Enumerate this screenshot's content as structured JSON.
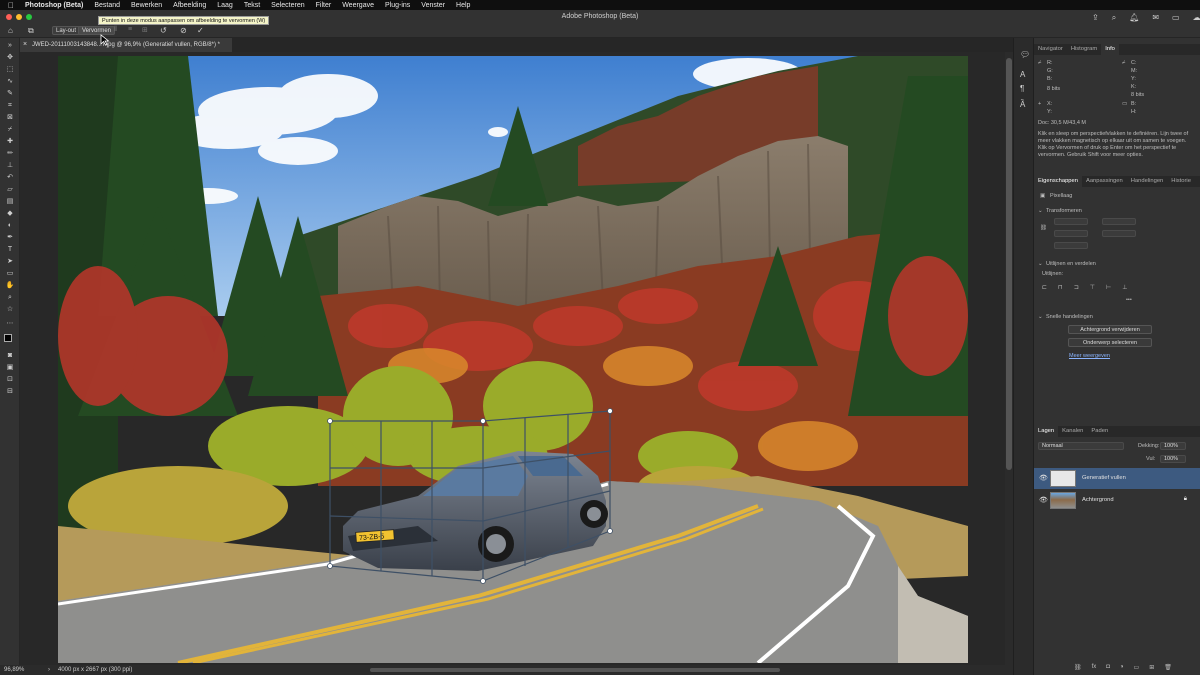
{
  "menubar": {
    "app_name": "Photoshop (Beta)",
    "items": [
      "Bestand",
      "Bewerken",
      "Afbeelding",
      "Laag",
      "Tekst",
      "Selecteren",
      "Filter",
      "Weergave",
      "Plug-ins",
      "Venster",
      "Help"
    ]
  },
  "window": {
    "title": "Adobe Photoshop (Beta)"
  },
  "options_bar": {
    "layout_label": "Lay-out",
    "warp_label": "Vervormen",
    "tooltip": "Punten in deze modus aanpassen om afbeelding te vervormen (W)"
  },
  "document": {
    "tab_title": "JWED-20111003143848...7.jpg @ 96,9% (Generatief vullen, RGB/8*) *",
    "plate_text": "73-ZB-5"
  },
  "status": {
    "zoom": "96,89%",
    "info": "4000 px x 2667 px (300 ppi)"
  },
  "info_panel": {
    "tabs": [
      "Navigator",
      "Histogram",
      "Info"
    ],
    "active_tab": "Info",
    "rgb_labels": [
      "R:",
      "G:",
      "B:"
    ],
    "cmyk_labels": [
      "C:",
      "M:",
      "Y:",
      "K:"
    ],
    "bits_left": "8 bits",
    "bits_right": "8 bits",
    "x_label": "X:",
    "y_label": "Y:",
    "w_label": "B:",
    "h_label": "H:",
    "doc_size": "Doc: 30,5 M/43,4 M",
    "help_text": "Klik en sleep om perspectiefvlakken te definiëren. Lijn twee of meer vlakken magnetisch op elkaar uit om samen te voegen. Klik op Vervormen of druk op Enter om het perspectief te vervormen. Gebruik Shift voor meer opties."
  },
  "properties_panel": {
    "tabs": [
      "Eigenschappen",
      "Aanpassingen",
      "Handelingen",
      "Historie"
    ],
    "active_tab": "Eigenschappen",
    "layer_type": "Pixellaag",
    "transform_label": "Transformeren",
    "align_label": "Uitlijnen en verdelen",
    "align_sub": "Uitlijnen:",
    "quick_actions_label": "Snelle handelingen",
    "remove_bg": "Achtergrond verwijderen",
    "select_subject": "Onderwerp selecteren",
    "more_link": "Meer weergeven"
  },
  "layers_panel": {
    "tabs": [
      "Lagen",
      "Kanalen",
      "Paden"
    ],
    "active_tab": "Lagen",
    "blend_mode": "Normaal",
    "opacity_label": "Dekking:",
    "opacity_value": "100%",
    "fill_label": "Vul:",
    "fill_value": "100%",
    "layers": [
      {
        "name": "Generatief vullen",
        "selected": true
      },
      {
        "name": "Achtergrond",
        "selected": false
      }
    ]
  },
  "colors": {
    "accent": "#3d5a80",
    "sky": "#6aa6e0",
    "selection": "#3e5066"
  }
}
